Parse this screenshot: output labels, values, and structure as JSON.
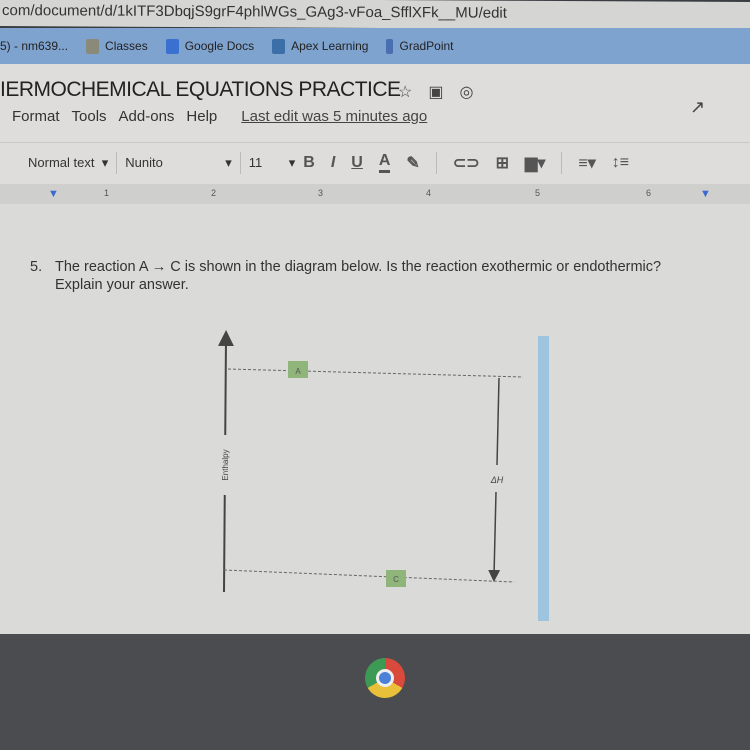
{
  "browser": {
    "url": "com/document/d/1kITF3DbqjS9grF4phlWGs_GAg3-vFoa_SfflXFk__MU/edit",
    "bookmarks": [
      {
        "label": "5) - nm639..."
      },
      {
        "label": "Classes"
      },
      {
        "label": "Google Docs"
      },
      {
        "label": "Apex Learning"
      },
      {
        "label": "GradPoint"
      }
    ]
  },
  "doc": {
    "title": "IERMOCHEMICAL EQUATIONS PRACTICE",
    "menu": [
      "Format",
      "Tools",
      "Add-ons",
      "Help"
    ],
    "last_edit": "Last edit was 5 minutes ago",
    "toolbar": {
      "style": "Normal text",
      "font": "Nunito",
      "size": "11",
      "bold": "B",
      "italic": "I",
      "underline": "U",
      "color": "A"
    },
    "ruler": [
      "1",
      "2",
      "3",
      "4",
      "5",
      "6"
    ]
  },
  "question": {
    "number": "5.",
    "text": "The reaction A → C is shown in the diagram below. Is the reaction exothermic or endothermic? Explain your answer."
  },
  "diagram": {
    "y_axis": "Enthalpy",
    "top_label": "A",
    "bottom_label": "C",
    "delta": "ΔH",
    "box_color": "#8fb57a"
  }
}
